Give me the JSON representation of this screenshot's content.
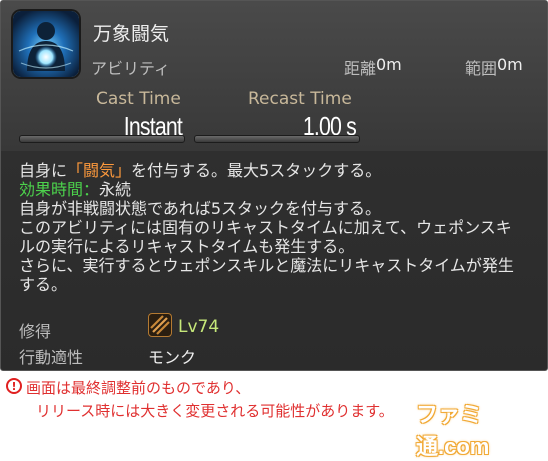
{
  "skill": {
    "icon": "monk-meditation-icon",
    "name": "万象闘気",
    "type": "アビリティ",
    "range_label": "距離",
    "range_value": "0m",
    "radius_label": "範囲",
    "radius_value": "0m"
  },
  "timing": {
    "cast_label": "Cast Time",
    "cast_value": "Instant",
    "recast_label": "Recast Time",
    "recast_value": "1.00 s"
  },
  "description": {
    "line1_a": "自身に",
    "line1_hl": "「闘気」",
    "line1_b": "を付与する。最大5スタックする。",
    "line2_label": "効果時間：",
    "line2_value": "永続",
    "line3": "自身が非戦闘状態であれば5スタックを付与する。",
    "line4": "このアビリティには固有のリキャストタイムに加えて、ウェポンスキ",
    "line5": "ルの実行によるリキャストタイムも発生する。",
    "line6": "さらに、実行するとウェポンスキルと魔法にリキャストタイムが発生",
    "line7": "する。"
  },
  "requirements": {
    "learn_label": "修得",
    "job_icon": "monk-job-icon",
    "level": "Lv74",
    "job_label": "行動適性",
    "job_name": "モンク"
  },
  "notice": {
    "icon": "exclamation-icon",
    "line1": "画面は最終調整前のものであり、",
    "line2": "リリース時には大きく変更される可能性があります。",
    "watermark": "ファミ通.com"
  },
  "colors": {
    "highlight_orange": "#ff9a3c",
    "highlight_green": "#4cd24c",
    "level_green": "#c6e87a",
    "notice_red": "#e03030"
  }
}
